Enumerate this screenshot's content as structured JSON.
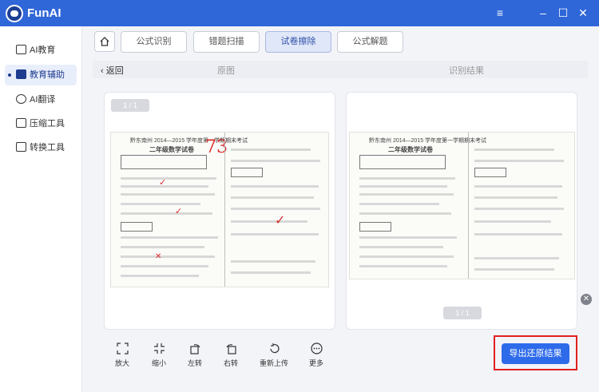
{
  "app": {
    "title": "FunAI",
    "brand_color": "#2f66d8"
  },
  "window_controls": {
    "menu_icon": "hamburger-icon",
    "min_icon": "minimize-icon",
    "max_icon": "maximize-icon",
    "close_icon": "close-icon"
  },
  "sidebar": {
    "items": [
      {
        "label": "AI教育",
        "icon": "graduation-cap-icon"
      },
      {
        "label": "教育辅助",
        "icon": "book-icon"
      },
      {
        "label": "AI翻译",
        "icon": "translate-icon"
      },
      {
        "label": "压缩工具",
        "icon": "compress-icon"
      },
      {
        "label": "转换工具",
        "icon": "convert-icon"
      }
    ],
    "active_index": 1
  },
  "tabs": [
    {
      "label": "公式识别"
    },
    {
      "label": "错题扫描"
    },
    {
      "label": "试卷擦除"
    },
    {
      "label": "公式解题"
    }
  ],
  "subbar": {
    "back_label": "返回",
    "original_label": "原图",
    "result_label": "识别结果"
  },
  "left_panel": {
    "page_indicator": "1 / 1"
  },
  "right_panel": {
    "page_indicator": "1 / 1"
  },
  "paper": {
    "header": "黔东南州 2014—2015 学年度第一学期期末考试",
    "title": "二年级数学试卷",
    "score_mark": "73"
  },
  "toolbar": [
    {
      "label": "放大",
      "icon": "zoom-in-icon"
    },
    {
      "label": "缩小",
      "icon": "zoom-out-icon"
    },
    {
      "label": "左转",
      "icon": "rotate-left-icon"
    },
    {
      "label": "右转",
      "icon": "rotate-right-icon"
    },
    {
      "label": "重新上传",
      "icon": "reupload-icon"
    },
    {
      "label": "更多",
      "icon": "more-icon"
    }
  ],
  "export_button": {
    "label": "导出还原结果",
    "color": "#2e6bea",
    "highlight_color": "#e02020"
  }
}
